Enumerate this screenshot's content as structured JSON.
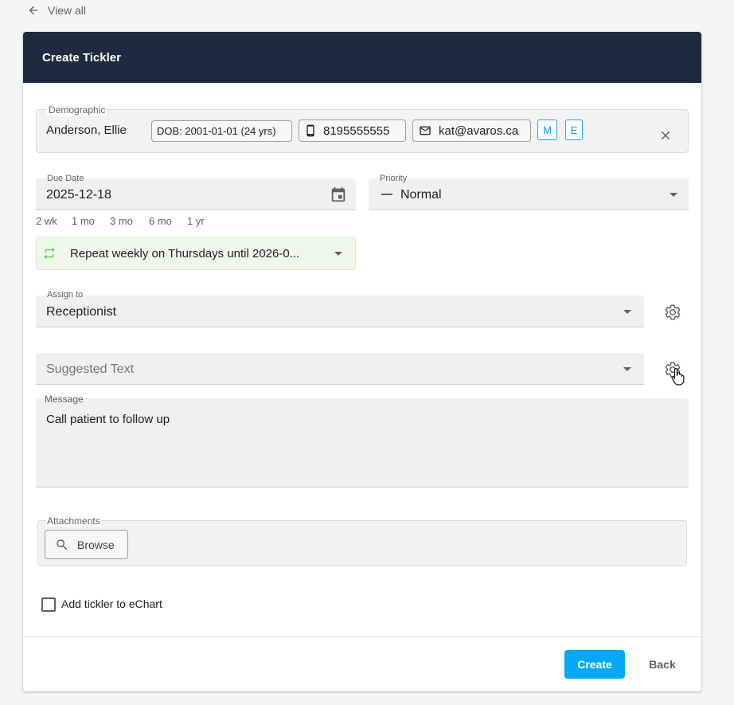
{
  "nav": {
    "back_label": "View all"
  },
  "header": {
    "title": "Create Tickler"
  },
  "demographic": {
    "label": "Demographic",
    "name": "Anderson, Ellie",
    "dob": "DOB: 2001-01-01 (24 yrs)",
    "phone": "8195555555",
    "email": "kat@avaros.ca",
    "tag_m": "M",
    "tag_e": "E"
  },
  "due_date": {
    "label": "Due Date",
    "value": "2025-12-18",
    "quick_options": [
      "2 wk",
      "1 mo",
      "3 mo",
      "6 mo",
      "1 yr"
    ]
  },
  "priority": {
    "label": "Priority",
    "value": "Normal"
  },
  "repeat": {
    "value": "Repeat weekly on Thursdays until 2026-0..."
  },
  "assign_to": {
    "label": "Assign to",
    "value": "Receptionist"
  },
  "suggested_text": {
    "placeholder": "Suggested Text"
  },
  "message": {
    "label": "Message",
    "value": "Call patient to follow up"
  },
  "attachments": {
    "label": "Attachments",
    "browse_label": "Browse"
  },
  "echart": {
    "label": "Add tickler to eChart",
    "checked": false
  },
  "actions": {
    "create_label": "Create",
    "back_label": "Back"
  },
  "colors": {
    "header_bg": "#1e2a3d",
    "primary": "#03a9f4",
    "repeat_bg": "#eef8ea",
    "repeat_icon": "#7cc26a",
    "tag": "#1d9bd8"
  }
}
